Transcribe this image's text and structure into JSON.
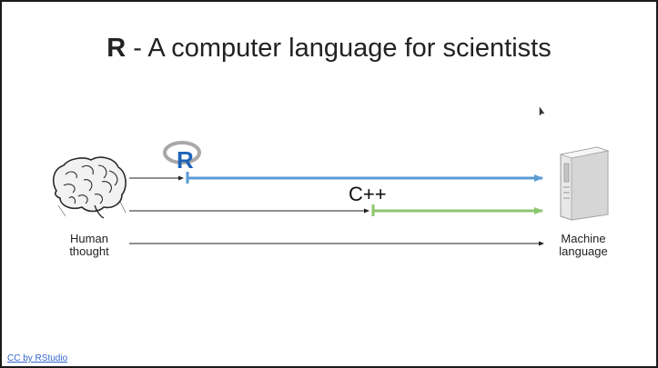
{
  "slide": {
    "title_brand": "R",
    "title_rest": " - A computer language for scientists"
  },
  "diagram": {
    "source_label": [
      "Human",
      "thought"
    ],
    "target_label": [
      "Machine",
      "language"
    ],
    "cpp_label": "C++",
    "r_logo_letter": "R",
    "colors": {
      "r_arrow": "#5b9bd5",
      "cpp_arrow": "#8dc56e",
      "plain_arrow": "#222222",
      "r_logo_blue": "#1e63b8",
      "r_logo_ring": "#a8a8a8"
    },
    "icons": {
      "source": "brain-icon",
      "target": "server-tower-icon",
      "r": "r-logo-icon"
    }
  },
  "footer": {
    "credit": "CC by RStudio"
  }
}
